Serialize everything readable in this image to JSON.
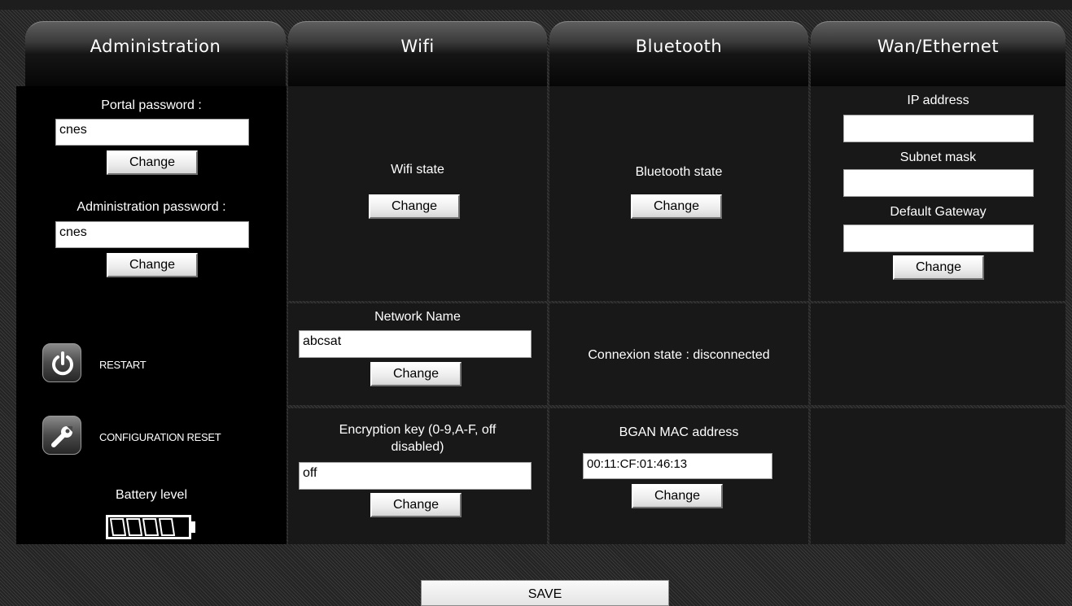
{
  "tabs": {
    "administration": "Administration",
    "wifi": "Wifi",
    "bluetooth": "Bluetooth",
    "wan": "Wan/Ethernet"
  },
  "admin": {
    "portal_password_label": "Portal password :",
    "portal_password_value": "cnes",
    "admin_password_label": "Administration password :",
    "admin_password_value": "cnes",
    "change_label": "Change",
    "restart_label": "RESTART",
    "restart_icon": "power-icon",
    "config_reset_label": "CONFIGURATION RESET",
    "config_reset_icon": "wrench-icon",
    "battery_label": "Battery level",
    "battery_icon": "battery-icon",
    "battery_level_fraction": 0.8
  },
  "wifi": {
    "state_label": "Wifi state",
    "network_name_label": "Network Name",
    "network_name_value": "abcsat",
    "encryption_label_line1": "Encryption key (0-9,A-F, off",
    "encryption_label_line2": "disabled)",
    "encryption_value": "off",
    "change_label": "Change"
  },
  "bluetooth": {
    "state_label": "Bluetooth state",
    "connexion_state": "Connexion state : disconnected",
    "mac_label": "BGAN MAC address",
    "mac_value": "00:11:CF:01:46:13",
    "change_label": "Change"
  },
  "wan": {
    "ip_label": "IP address",
    "ip_value": "",
    "subnet_label": "Subnet mask",
    "subnet_value": "",
    "gateway_label": "Default Gateway",
    "gateway_value": "",
    "change_label": "Change"
  },
  "footer": {
    "save_label": "SAVE"
  }
}
